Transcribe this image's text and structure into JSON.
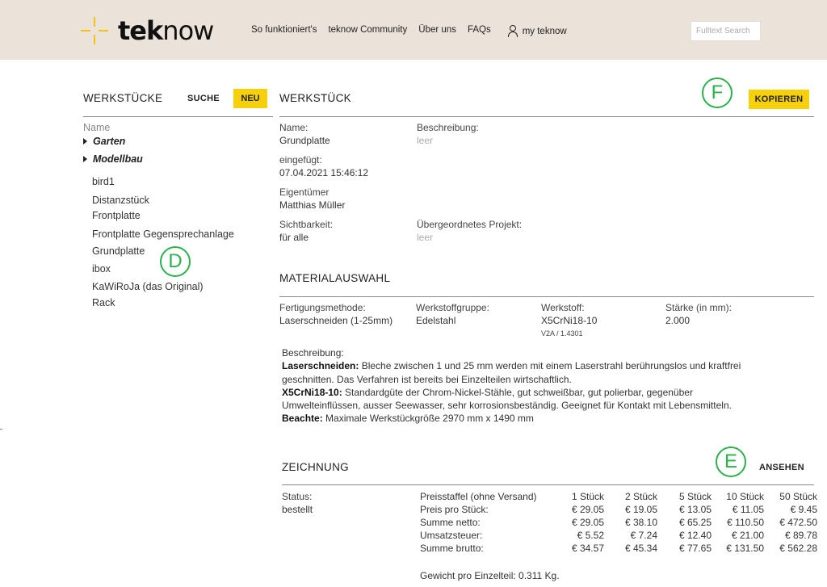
{
  "header": {
    "logo": {
      "bold": "tek",
      "thin": "now"
    },
    "nav": [
      "So funktioniert's",
      "teknow Community",
      "Über uns",
      "FAQs"
    ],
    "user_label": "my teknow",
    "search_placeholder": "Fulltext Search"
  },
  "left": {
    "title": "WERKSTÜCKE",
    "suche": "SUCHE",
    "neu": "NEU",
    "column": "Name",
    "folders": [
      "Garten",
      "Modellbau"
    ],
    "items": [
      "bird1",
      "Distanzstück",
      "Frontplatte",
      "Frontplatte Gegensprechanlage",
      "Grundplatte",
      "ibox",
      "KaWiRoJa (das Original)",
      "Rack"
    ]
  },
  "annotations": {
    "d": "D",
    "e": "E",
    "f": "F"
  },
  "werkstueck": {
    "title": "WERKSTÜCK",
    "kopieren": "KOPIEREN",
    "name_label": "Name:",
    "name_value": "Grundplatte",
    "beschreibung_label": "Beschreibung:",
    "beschreibung_value": "leer",
    "eingefuegt_label": "eingefügt:",
    "eingefuegt_value": "07.04.2021 15:46:12",
    "eigentuemer_label": "Eigentümer",
    "eigentuemer_value": "Matthias Müller",
    "sichtbarkeit_label": "Sichtbarkeit:",
    "sichtbarkeit_value": "für alle",
    "projekt_label": "Übergeordnetes Projekt:",
    "projekt_value": "leer"
  },
  "material": {
    "title": "MATERIALAUSWAHL",
    "methode_label": "Fertigungsmethode:",
    "methode_value": "Laserschneiden (1-25mm)",
    "gruppe_label": "Werkstoffgruppe:",
    "gruppe_value": "Edelstahl",
    "werkstoff_label": "Werkstoff:",
    "werkstoff_value": "X5CrNi18-10",
    "werkstoff_sub": "V2A / 1.4301",
    "staerke_label": "Stärke (in mm):",
    "staerke_value": "2.000",
    "desc_label": "Beschreibung:",
    "laser_bold": "Laserschneiden:",
    "laser_text": " Bleche zwischen 1 und 25 mm werden mit einem Laserstrahl berührungslos und kraftfrei geschnitten. Das Verfahren ist bereits bei Einzelteilen wirtschaftlich.",
    "steel_bold": "X5CrNi18-10:",
    "steel_text": " Standardgüte der Chrom-Nickel-Stähle, gut schweißbar, gut polierbar, gegenüber Umwelteinflüssen, ausser Seewasser, sehr korrosionsbeständig. Geeignet für Kontakt mit Lebensmitteln.",
    "note_bold": "Beachte:",
    "note_text": " Maximale Werkstückgröße 2970 mm x 1490 mm"
  },
  "zeichnung": {
    "title": "ZEICHNUNG",
    "ansehen": "ANSEHEN",
    "status_label": "Status:",
    "status_value": "bestellt",
    "price_header": {
      "label": "Preisstaffel (ohne Versand)",
      "cols": [
        "1 Stück",
        "2 Stück",
        "5 Stück",
        "10 Stück",
        "50 Stück"
      ]
    },
    "price_rows": [
      {
        "label": "Preis pro Stück:",
        "values": [
          "€ 29.05",
          "€ 19.05",
          "€ 13.05",
          "€ 11.05",
          "€ 9.45"
        ]
      },
      {
        "label": "Summe netto:",
        "values": [
          "€ 29.05",
          "€ 38.10",
          "€ 65.25",
          "€ 110.50",
          "€ 472.50"
        ]
      },
      {
        "label": "Umsatzsteuer:",
        "values": [
          "€ 5.52",
          "€ 7.24",
          "€ 12.40",
          "€ 21.00",
          "€ 89.78"
        ]
      },
      {
        "label": "Summe brutto:",
        "values": [
          "€ 34.57",
          "€ 45.34",
          "€ 77.65",
          "€ 131.50",
          "€ 562.28"
        ]
      }
    ],
    "gewicht": "Gewicht pro Einzelteil: 0.311 Kg."
  }
}
